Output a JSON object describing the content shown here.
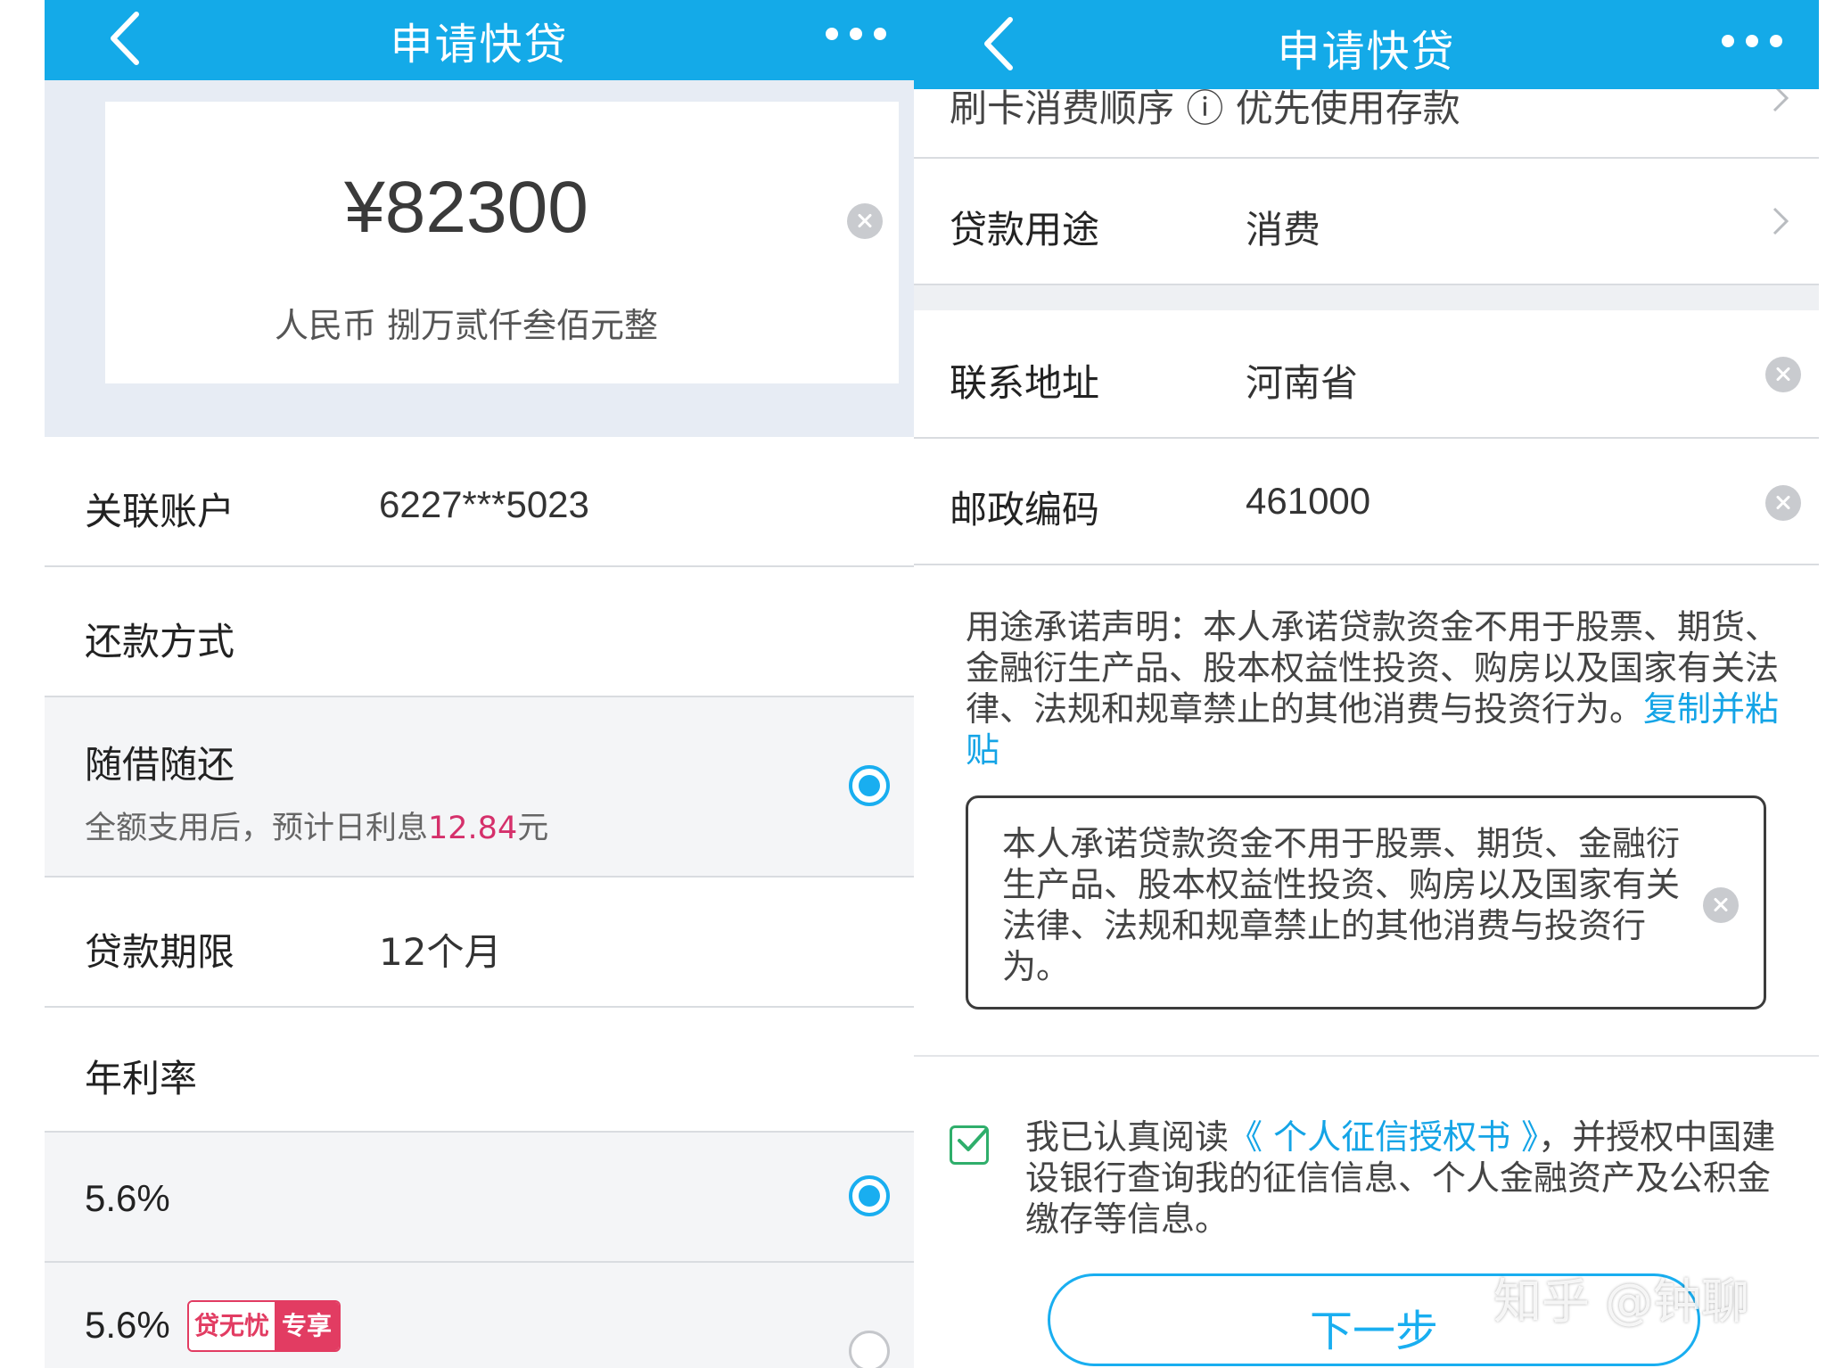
{
  "left": {
    "title": "申请快贷",
    "amount": "¥82300",
    "amount_words": "人民币  捌万贰仟叁佰元整",
    "account_label": "关联账户",
    "account_value": "6227***5023",
    "repay_label": "还款方式",
    "repay_option_title": "随借随还",
    "repay_option_sub_prefix": "全额支用后，预计日利息",
    "repay_option_interest": "12.84",
    "repay_option_unit": "元",
    "term_label": "贷款期限",
    "term_value": "12个月",
    "rate_label": "年利率",
    "rate_option1": "5.6%",
    "rate_option2": "5.6%",
    "badge_left": "贷无忧",
    "badge_right": "专享"
  },
  "right": {
    "title": "申请快贷",
    "partial_row_text": "刷卡消费顺序  ⓘ   优先使用存款",
    "purpose_label": "贷款用途",
    "purpose_value": "消费",
    "address_label": "联系地址",
    "address_value": "河南省",
    "postal_label": "邮政编码",
    "postal_value": "461000",
    "declare_text": "用途承诺声明：本人承诺贷款资金不用于股票、期货、金融衍生产品、股本权益性投资、购房以及国家有关法律、法规和规章禁止的其他消费与投资行为。",
    "declare_link": "复制并粘贴",
    "declare_box_text": "本人承诺贷款资金不用于股票、期货、金融衍生产品、股本权益性投资、购房以及国家有关法律、法规和规章禁止的其他消费与投资行为。",
    "agree_prefix": "我已认真阅读",
    "agree_link": "《 个人征信授权书 》",
    "agree_suffix": "，并授权中国建设银行查询我的征信信息、个人金融资产及公积金缴存等信息。",
    "next_button": "下一步"
  },
  "watermark": "知乎 @钟聊",
  "colors": {
    "header": "#14aae8",
    "accent": "#19aef0",
    "interest": "#d5306b",
    "check": "#2fae6b"
  }
}
